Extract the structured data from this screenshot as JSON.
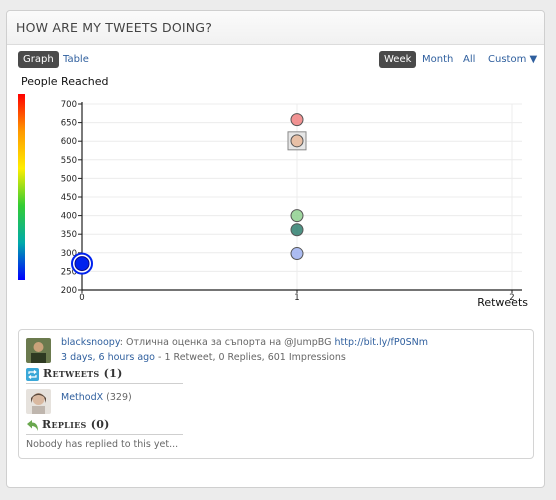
{
  "panel": {
    "title": "HOW ARE MY TWEETS DOING?"
  },
  "view_toggle": {
    "graph": "Graph",
    "table": "Table",
    "active": "graph"
  },
  "range_toggle": {
    "week": "Week",
    "month": "Month",
    "all": "All",
    "custom": "Custom ▼",
    "active": "week"
  },
  "colors": {
    "scale_top": "#ff0000",
    "scale_bottom": "#0000ff",
    "link": "#2f5f9e",
    "active_pill": "#4a4a4a"
  },
  "chart_data": {
    "type": "scatter",
    "ylabel": "People Reached",
    "xlabel": "Retweets",
    "xlim": [
      0,
      2
    ],
    "ylim": [
      200,
      700
    ],
    "x_ticks": [
      0,
      1,
      2
    ],
    "y_ticks": [
      200,
      250,
      300,
      350,
      400,
      450,
      500,
      550,
      600,
      650,
      700
    ],
    "grid": true,
    "color_scale": "red (high) to blue (low)",
    "points": [
      {
        "x": 0,
        "y": 271,
        "color": "#0022ee",
        "highlight": true
      },
      {
        "x": 1,
        "y": 658,
        "color": "#f08080"
      },
      {
        "x": 1,
        "y": 601,
        "color": "#e8b89a",
        "selected": true
      },
      {
        "x": 1,
        "y": 400,
        "color": "#8fd08f"
      },
      {
        "x": 1,
        "y": 362,
        "color": "#2f7f6f"
      },
      {
        "x": 1,
        "y": 298,
        "color": "#9fb2f0"
      }
    ]
  },
  "tweet": {
    "author": "blacksnoopy",
    "text": "Отлична оценка за съпорта на @JumpBG",
    "url": "http://bit.ly/fP0SNm",
    "time": "3 days, 6 hours ago",
    "stats": "- 1 Retweet, 0 Replies, 601 Impressions",
    "retweets_title": "Retweets (1)",
    "retweeters": [
      {
        "name": "MethodX",
        "count": "(329)"
      }
    ],
    "replies_title": "Replies (0)",
    "replies_empty": "Nobody has replied to this yet..."
  }
}
